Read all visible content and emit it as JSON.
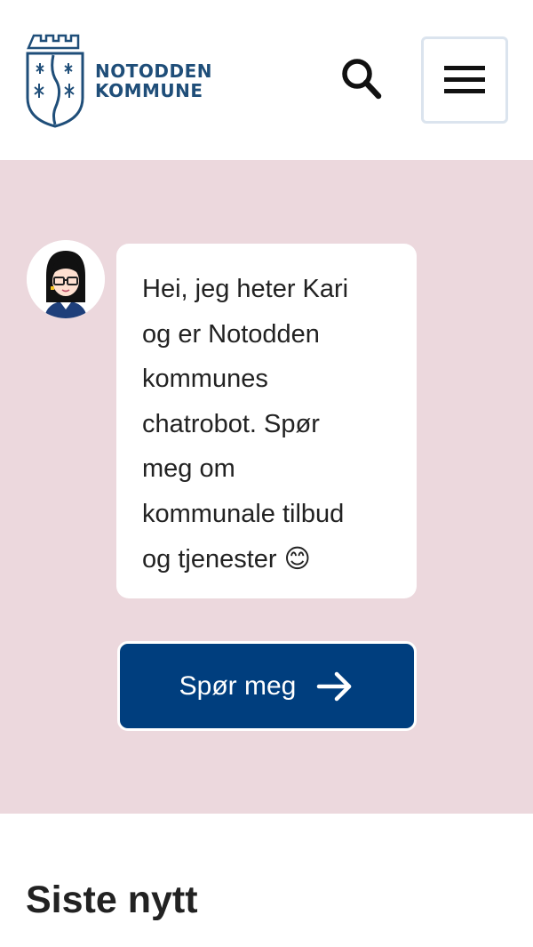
{
  "header": {
    "logo": {
      "line1": "NOTODDEN",
      "line2": "KOMMUNE",
      "color": "#1f4e79"
    },
    "search_icon": "search-icon",
    "menu_icon": "hamburger-menu-icon"
  },
  "chat": {
    "background_color": "#ecd8dd",
    "avatar_icon": "chatbot-avatar-icon",
    "message": "Hei, jeg heter Kari\nog er Notodden\nkommunes\nchatrobot. Spør\nmeg om\nkommunale tilbud\nog tjenester 😊",
    "cta_label": "Spør meg",
    "cta_icon": "arrow-right-icon",
    "cta_color": "#003e7e"
  },
  "news": {
    "title": "Siste nytt"
  }
}
